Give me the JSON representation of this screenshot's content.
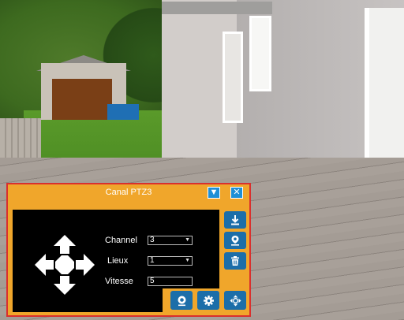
{
  "panel": {
    "title": "Canal PTZ3",
    "minimize_icon": "triangle-down-icon",
    "close_icon": "close-icon"
  },
  "controls": {
    "channel": {
      "label": "Channel",
      "value": "3"
    },
    "lieux": {
      "label": "Lieux",
      "value": "1"
    },
    "vitesse": {
      "label": "Vitesse",
      "value": "5"
    }
  },
  "side_buttons": [
    "download-icon",
    "location-pin-icon",
    "trash-icon"
  ],
  "bottom_buttons": [
    "camera-icon",
    "gear-icon",
    "move-arrows-icon"
  ],
  "colors": {
    "panel_bg": "#f0a62b",
    "panel_border": "#d9302e",
    "button_blue": "#1c6ea9",
    "title_button_blue": "#1e8fd6"
  }
}
